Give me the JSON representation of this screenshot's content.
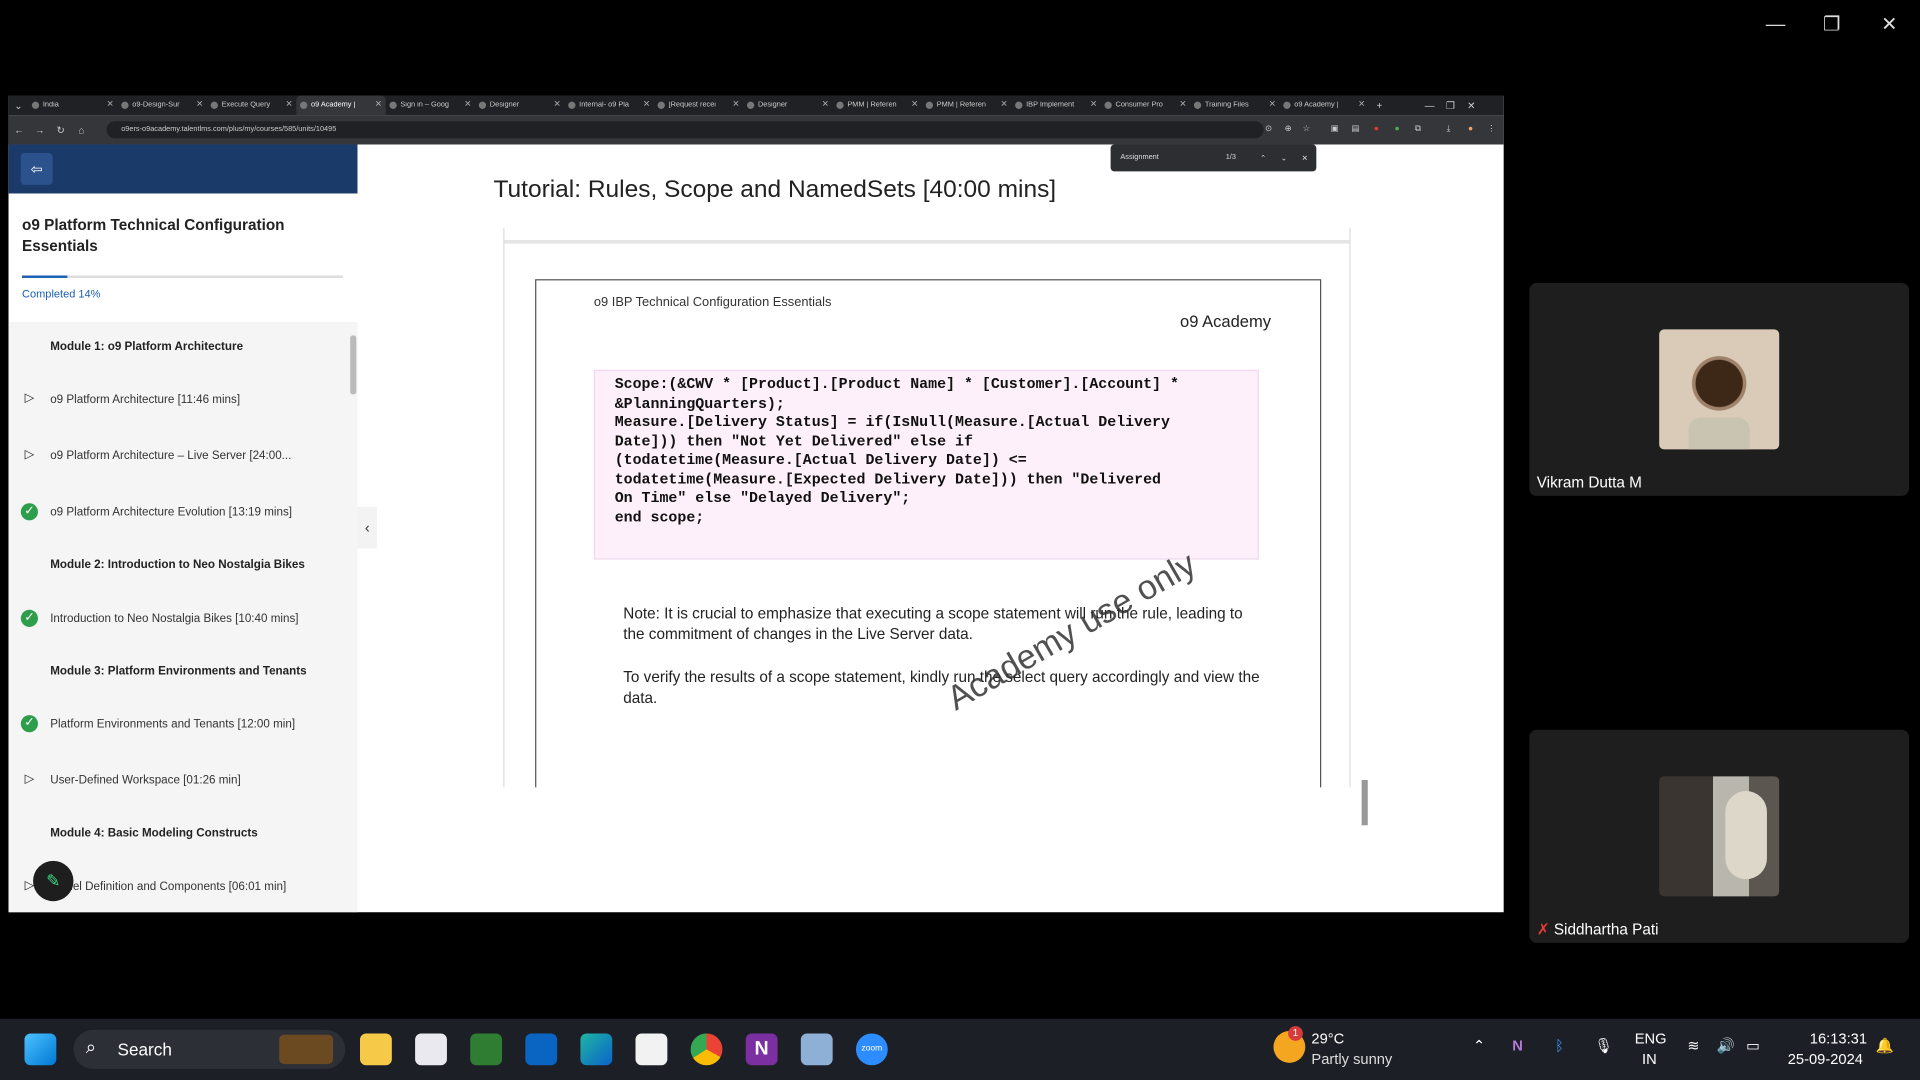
{
  "window": {
    "minimize": "—",
    "restore": "❐",
    "close": "✕"
  },
  "browser": {
    "tabs": [
      {
        "label": "India",
        "active": false
      },
      {
        "label": "o9-Design-Sur",
        "active": false
      },
      {
        "label": "Execute Query",
        "active": false
      },
      {
        "label": "o9 Academy |",
        "active": true
      },
      {
        "label": "Sign in – Goog",
        "active": false
      },
      {
        "label": "Designer",
        "active": false
      },
      {
        "label": "Internal- o9 Pla",
        "active": false
      },
      {
        "label": "[Request recei",
        "active": false
      },
      {
        "label": "Designer",
        "active": false
      },
      {
        "label": "PMM | Referen",
        "active": false
      },
      {
        "label": "PMM | Referen",
        "active": false
      },
      {
        "label": "IBP Implement",
        "active": false
      },
      {
        "label": "Consumer Pro",
        "active": false
      },
      {
        "label": "Training Files",
        "active": false
      },
      {
        "label": "o9 Academy |",
        "active": false
      }
    ],
    "new_tab": "+",
    "url": "o9ers-o9academy.talentlms.com/plus/my/courses/585/units/10495",
    "find": {
      "query": "Assignment",
      "count": "1/3"
    }
  },
  "sidebar": {
    "course_title": "o9 Platform Technical Configuration Essentials",
    "progress_label": "Completed 14%",
    "progress": 0.14,
    "items": [
      {
        "label": "Module 1: o9 Platform Architecture",
        "kind": "module",
        "icon": "none"
      },
      {
        "label": "o9 Platform Architecture [11:46 mins]",
        "kind": "unit",
        "icon": "play-icon"
      },
      {
        "label": "o9 Platform Architecture – Live Server [24:00...",
        "kind": "unit",
        "icon": "play-icon"
      },
      {
        "label": "o9 Platform Architecture Evolution [13:19 mins]",
        "kind": "unit",
        "icon": "check-icon"
      },
      {
        "label": "Module 2: Introduction to Neo Nostalgia Bikes",
        "kind": "module",
        "icon": "none"
      },
      {
        "label": "Introduction to Neo Nostalgia Bikes [10:40 mins]",
        "kind": "unit",
        "icon": "check-icon"
      },
      {
        "label": "Module 3: Platform Environments and Tenants",
        "kind": "module",
        "icon": "none"
      },
      {
        "label": "Platform Environments and Tenants [12:00 min]",
        "kind": "unit",
        "icon": "check-icon"
      },
      {
        "label": "User-Defined Workspace [01:26 min]",
        "kind": "unit",
        "icon": "play-icon"
      },
      {
        "label": "Module 4: Basic Modeling Constructs",
        "kind": "module",
        "icon": "none"
      },
      {
        "label": "Model Definition and Components [06:01 min]",
        "kind": "unit",
        "icon": "play-icon"
      }
    ]
  },
  "main": {
    "title": "Tutorial: Rules, Scope and NamedSets [40:00 mins]",
    "slide": {
      "header": "o9 IBP Technical Configuration Essentials",
      "logo": "o9 Academy",
      "code": "Scope:(&CWV * [Product].[Product Name] * [Customer].[Account] *\n&PlanningQuarters);\nMeasure.[Delivery Status] = if(IsNull(Measure.[Actual Delivery\nDate])) then \"Not Yet Delivered\" else if\n(todatetime(Measure.[Actual Delivery Date]) <=\ntodatetime(Measure.[Expected Delivery Date])) then \"Delivered\nOn Time\" else \"Delayed Delivery\";\nend scope;",
      "note1": "Note: It is crucial to emphasize that executing a scope statement will run the rule, leading to the commitment of changes in the Live Server data.",
      "note2": "To verify the results of a scope statement, kindly run the select query accordingly and view the data.",
      "watermark": "Academy use only"
    }
  },
  "participants": [
    {
      "name": "Vikram Dutta M",
      "muted": false
    },
    {
      "name": "Siddhartha Pati",
      "muted": true
    }
  ],
  "taskbar": {
    "search_placeholder": "Search",
    "weather": {
      "temp": "29°C",
      "desc": "Partly sunny",
      "badge": "1"
    },
    "language": [
      "ENG",
      "IN"
    ],
    "time": "16:13:31",
    "date": "25-09-2024"
  }
}
